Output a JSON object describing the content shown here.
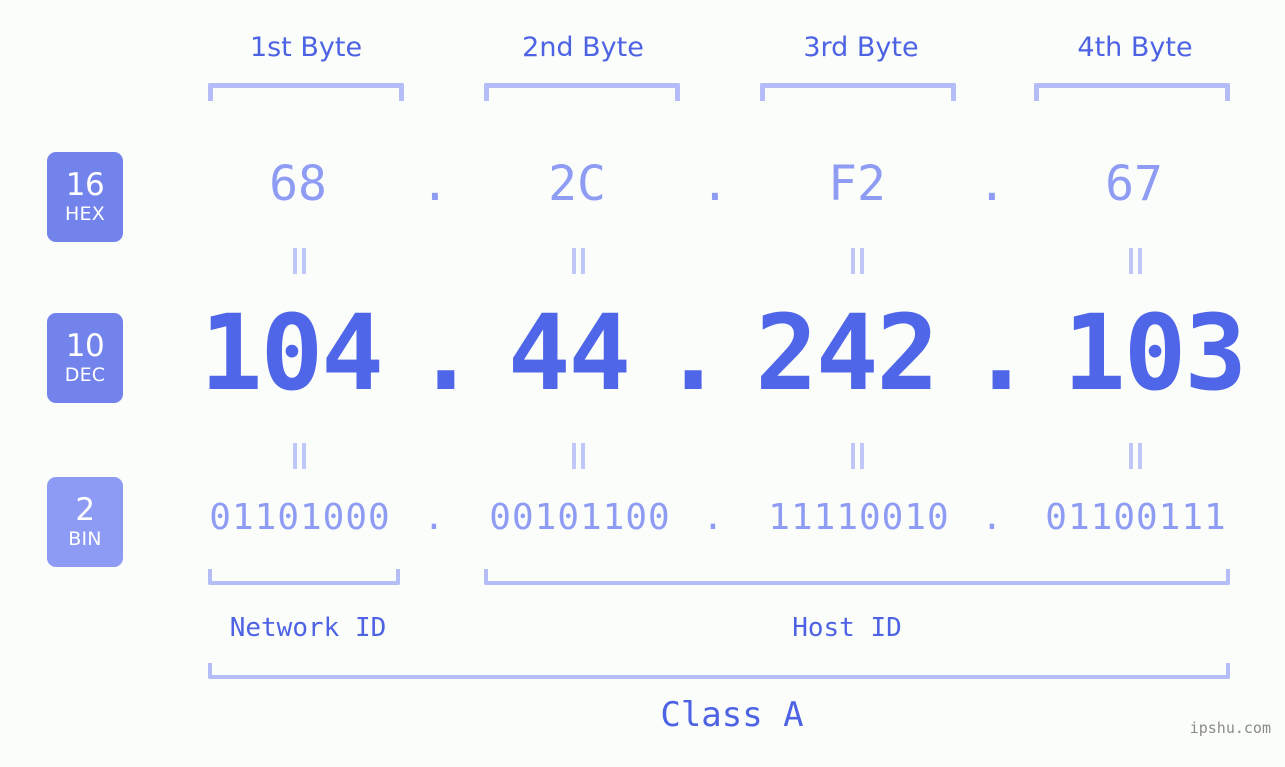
{
  "page": {
    "background_color": "#fbfdfa",
    "accent_color": "#4d63e4",
    "light_accent_color": "#8e9cf3",
    "bracket_color": "#b4bdf7",
    "badge_color": "#7383ec",
    "badge_color_light": "#8d9bf4"
  },
  "headers": {
    "bytes": [
      {
        "label": "1st Byte"
      },
      {
        "label": "2nd Byte"
      },
      {
        "label": "3rd Byte"
      },
      {
        "label": "4th Byte"
      }
    ]
  },
  "bases": [
    {
      "number": "16",
      "name": "HEX"
    },
    {
      "number": "10",
      "name": "DEC"
    },
    {
      "number": "2",
      "name": "BIN"
    }
  ],
  "rows": {
    "hex": {
      "base_number": "16",
      "base_name": "HEX",
      "values": [
        "68",
        "2C",
        "F2",
        "67"
      ],
      "separator": "."
    },
    "dec": {
      "base_number": "10",
      "base_name": "DEC",
      "values": [
        "104",
        "44",
        "242",
        "103"
      ],
      "separator": ".",
      "full": "104.44.242.103"
    },
    "bin": {
      "base_number": "2",
      "base_name": "BIN",
      "values": [
        "01101000",
        "00101100",
        "11110010",
        "01100111"
      ],
      "separator": ".",
      "full": "01101000.00101100.11110010.01100111"
    }
  },
  "equality_marks": {
    "symbol": "=",
    "count_per_row": 4,
    "rows": 2
  },
  "footer": {
    "network_id_label": "Network ID",
    "host_id_label": "Host ID",
    "class_label": "Class A",
    "watermark": "ipshu.com"
  },
  "chart_data": {
    "type": "table",
    "title": "IP Address 104.44.242.103 byte breakdown",
    "categories": [
      "1st Byte",
      "2nd Byte",
      "3rd Byte",
      "4th Byte"
    ],
    "series": [
      {
        "name": "HEX",
        "values": [
          "68",
          "2C",
          "F2",
          "67"
        ]
      },
      {
        "name": "DEC",
        "values": [
          "104",
          "44",
          "242",
          "103"
        ]
      },
      {
        "name": "BIN",
        "values": [
          "01101000",
          "00101100",
          "11110010",
          "01100111"
        ]
      }
    ],
    "annotations": {
      "network_id_span": [
        "1st Byte"
      ],
      "host_id_span": [
        "2nd Byte",
        "3rd Byte",
        "4th Byte"
      ],
      "class": "Class A"
    }
  }
}
